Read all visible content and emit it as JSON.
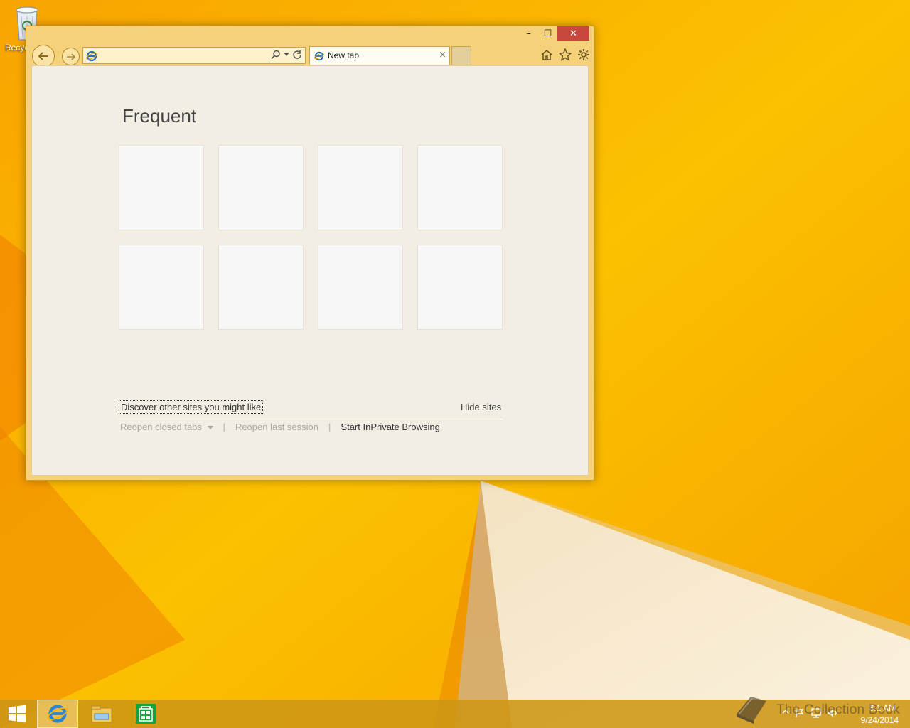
{
  "desktop": {
    "recycle_bin_label": "Recyc"
  },
  "window": {
    "controls": {
      "minimize": "–",
      "maximize": "☐",
      "close": "✕"
    },
    "address": {
      "value": "",
      "placeholder": ""
    },
    "tab": {
      "title": "New tab",
      "close": "×"
    },
    "toolbar_icons": [
      "home-icon",
      "favorites-star-icon",
      "settings-gear-icon"
    ]
  },
  "newtab": {
    "heading": "Frequent",
    "tiles": [
      "",
      "",
      "",
      "",
      "",
      "",
      "",
      ""
    ],
    "discover_link": "Discover other sites you might like",
    "hide_sites": "Hide sites",
    "reopen_closed_tabs": "Reopen closed tabs",
    "separator": "|",
    "reopen_last_session": "Reopen last session",
    "inprivate": "Start InPrivate Browsing"
  },
  "taskbar": {
    "apps": [
      "internet-explorer",
      "file-explorer",
      "store"
    ],
    "clock_time": "8:1 AM",
    "clock_date": "9/24/2014"
  },
  "watermark": {
    "text": "The Collection Book"
  },
  "colors": {
    "wallpaper": "#f7b400",
    "window_frame": "#f5d27a",
    "content_bg": "#f2eee4",
    "tile_bg": "#f7f7f7",
    "close_red": "#c7483c"
  }
}
